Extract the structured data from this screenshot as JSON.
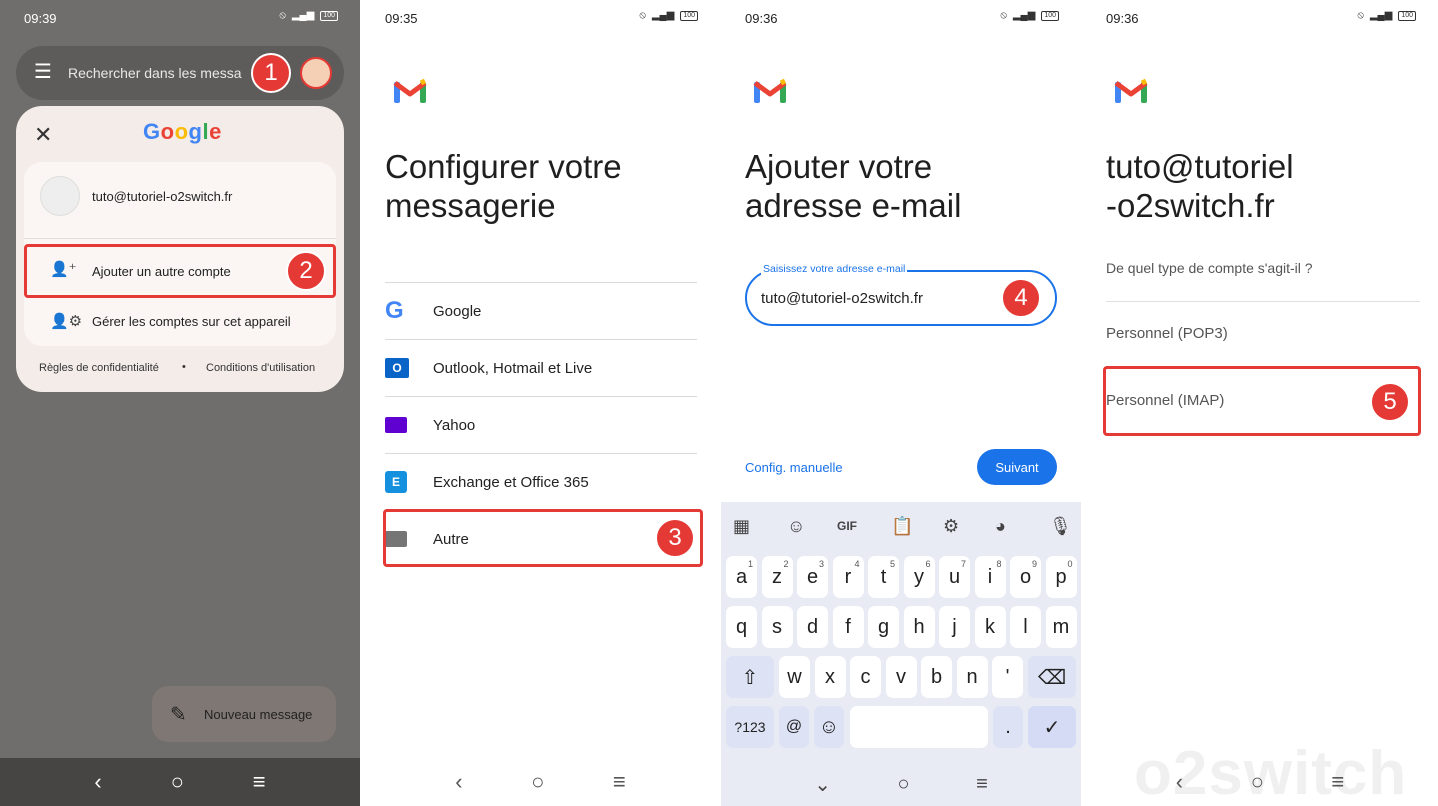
{
  "panel1": {
    "time": "09:39",
    "battery": "100",
    "search_placeholder": "Rechercher dans les messa",
    "google_logo": "Google",
    "account_email": "tuto@tutoriel-o2switch.fr",
    "add_account": "Ajouter un autre compte",
    "manage_accounts": "Gérer les comptes sur cet appareil",
    "privacy": "Règles de confidentialité",
    "dot": "•",
    "terms": "Conditions d'utilisation",
    "compose": "Nouveau message",
    "badge1": "1",
    "badge2": "2"
  },
  "panel2": {
    "time": "09:35",
    "battery": "100",
    "title_line1": "Configurer votre",
    "title_line2": "messagerie",
    "providers": [
      {
        "label": "Google",
        "icon": "google-icon"
      },
      {
        "label": "Outlook, Hotmail et Live",
        "icon": "outlook-icon"
      },
      {
        "label": "Yahoo",
        "icon": "yahoo-icon"
      },
      {
        "label": "Exchange et Office 365",
        "icon": "exchange-icon"
      },
      {
        "label": "Autre",
        "icon": "mail-icon"
      }
    ],
    "badge3": "3"
  },
  "panel3": {
    "time": "09:36",
    "battery": "100",
    "title_line1": "Ajouter votre",
    "title_line2": "adresse e-mail",
    "field_label": "Saisissez votre adresse e-mail",
    "field_value": "tuto@tutoriel-o2switch.fr",
    "manual_config": "Config. manuelle",
    "next": "Suivant",
    "badge4": "4",
    "keyboard": {
      "gif": "GIF",
      "row1": [
        "a",
        "z",
        "e",
        "r",
        "t",
        "y",
        "u",
        "i",
        "o",
        "p"
      ],
      "row1_digits": [
        "1",
        "2",
        "3",
        "4",
        "5",
        "6",
        "7",
        "8",
        "9",
        "0"
      ],
      "row2": [
        "q",
        "s",
        "d",
        "f",
        "g",
        "h",
        "j",
        "k",
        "l",
        "m"
      ],
      "row3": [
        "w",
        "x",
        "c",
        "v",
        "b",
        "n",
        "'"
      ],
      "sym": "?123",
      "at": "@",
      "period": "."
    }
  },
  "panel4": {
    "time": "09:36",
    "battery": "100",
    "title_line1": "tuto@tutoriel",
    "title_line2": "-o2switch.fr",
    "question": "De quel type de compte s'agit-il ?",
    "pop3": "Personnel (POP3)",
    "imap": "Personnel (IMAP)",
    "badge5": "5",
    "watermark": "o2switch"
  },
  "colors": {
    "accent_blue": "#1a73e8",
    "badge_red": "#e53935",
    "panel1_overlay": "#6f6e6c"
  }
}
